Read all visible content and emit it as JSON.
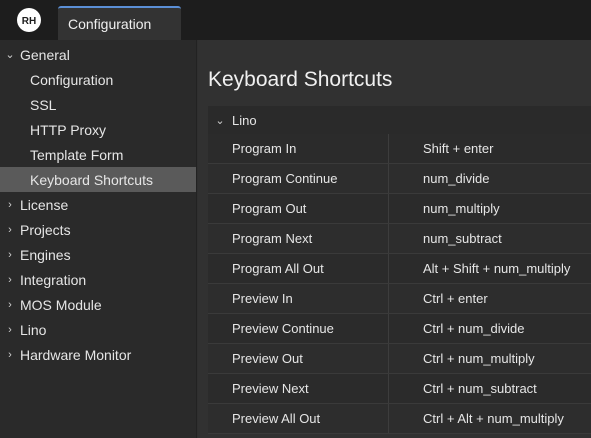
{
  "app": {
    "logo_text": "RH"
  },
  "tabs": [
    {
      "label": "Configuration"
    }
  ],
  "sidebar": {
    "items": [
      {
        "label": "General",
        "expanded": true,
        "children": [
          "Configuration",
          "SSL",
          "HTTP Proxy",
          "Template Form",
          "Keyboard Shortcuts"
        ]
      },
      {
        "label": "License"
      },
      {
        "label": "Projects"
      },
      {
        "label": "Engines"
      },
      {
        "label": "Integration"
      },
      {
        "label": "MOS Module"
      },
      {
        "label": "Lino"
      },
      {
        "label": "Hardware Monitor"
      }
    ],
    "active_child": "Keyboard Shortcuts"
  },
  "main": {
    "title": "Keyboard Shortcuts",
    "group_label": "Lino",
    "shortcuts": [
      {
        "name": "Program In",
        "key": "Shift + enter"
      },
      {
        "name": "Program Continue",
        "key": "num_divide"
      },
      {
        "name": "Program Out",
        "key": "num_multiply"
      },
      {
        "name": "Program Next",
        "key": "num_subtract"
      },
      {
        "name": "Program All Out",
        "key": "Alt + Shift + num_multiply"
      },
      {
        "name": "Preview In",
        "key": "Ctrl + enter"
      },
      {
        "name": "Preview Continue",
        "key": "Ctrl + num_divide"
      },
      {
        "name": "Preview Out",
        "key": "Ctrl + num_multiply"
      },
      {
        "name": "Preview Next",
        "key": "Ctrl + num_subtract"
      },
      {
        "name": "Preview All Out",
        "key": "Ctrl + Alt + num_multiply"
      }
    ]
  },
  "colors": {
    "accent": "#5b8fd6",
    "active_bg": "#5a5a5a",
    "background": "#2f2f2f"
  }
}
